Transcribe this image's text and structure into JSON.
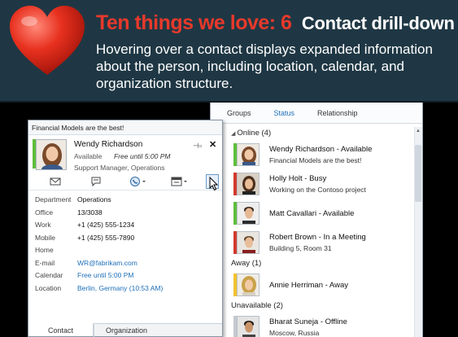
{
  "banner": {
    "title": "Ten things we love: 6",
    "subtitle": "Contact drill-down",
    "description": "Hovering over a contact displays expanded information about the person, including location, calendar, and organization structure."
  },
  "contact_list": {
    "tabs": [
      {
        "label": "Groups"
      },
      {
        "label": "Status"
      },
      {
        "label": "Relationship"
      }
    ],
    "groups": [
      {
        "label": "Online (4)",
        "contacts": [
          {
            "name": "Wendy Richardson - Available",
            "note": "Financial Models are the best!",
            "status": "available"
          },
          {
            "name": "Holly Holt - Busy",
            "note": "Working on the Contoso project",
            "status": "busy"
          },
          {
            "name": "Matt Cavallari - Available",
            "note": "",
            "status": "available"
          },
          {
            "name": "Robert Brown - In a Meeting",
            "note": "Building 5, Room 31",
            "status": "busy"
          }
        ]
      },
      {
        "label": "Away (1)",
        "contacts": [
          {
            "name": "Annie Herriman - Away",
            "note": "",
            "status": "away"
          }
        ]
      },
      {
        "label": "Unavailable (2)",
        "contacts": [
          {
            "name": "Bharat Suneja - Offline",
            "note": "Moscow, Russia",
            "status": "offline"
          }
        ]
      }
    ]
  },
  "card": {
    "note": "Financial Models are the best!",
    "name": "Wendy Richardson",
    "status": "Available",
    "free_until": "Free until 5:00 PM",
    "title": "Support Manager, Operations",
    "details": [
      {
        "label": "Department",
        "value": "Operations",
        "link": false
      },
      {
        "label": "Office",
        "value": "13/3038",
        "link": false
      },
      {
        "label": "Work",
        "value": "+1 (425) 555-1234",
        "link": false
      },
      {
        "label": "Mobile",
        "value": "+1 (425) 555-7890",
        "link": false
      },
      {
        "label": "Home",
        "value": "",
        "link": false
      },
      {
        "label": "E-mail",
        "value": "WR@fabrikam.com",
        "link": true
      },
      {
        "label": "Calendar",
        "value": "Free until 5:00 PM",
        "link": true
      },
      {
        "label": "Location",
        "value": "Berlin, Germany (10:53 AM)",
        "link": true
      }
    ],
    "tabs": [
      {
        "label": "Contact"
      },
      {
        "label": "Organization"
      }
    ]
  },
  "colors": {
    "banner_bg": "#1f3744",
    "title_red": "#e8392b",
    "available": "#5fbe3d",
    "busy": "#d13a2e",
    "away": "#f2c230",
    "offline": "#c4c9ce",
    "link": "#1e6fb8"
  }
}
